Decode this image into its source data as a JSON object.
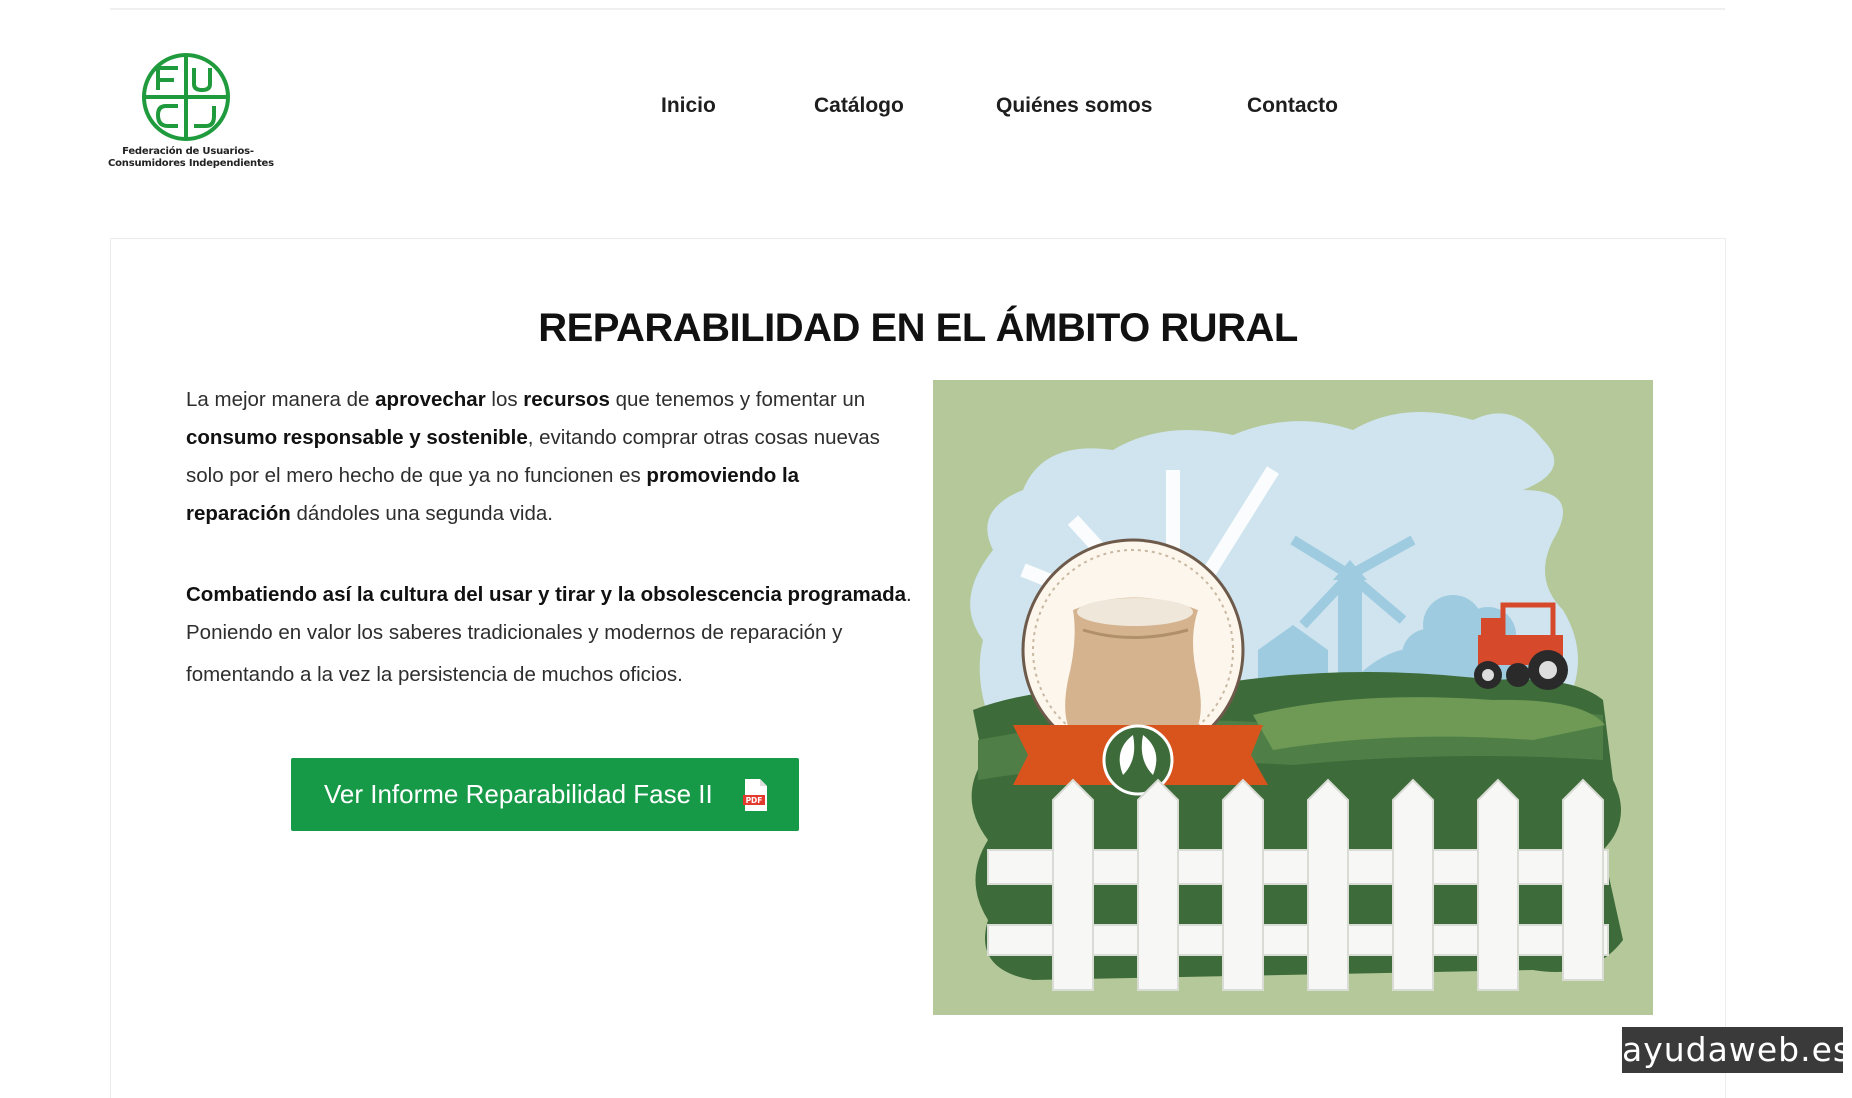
{
  "header": {
    "logo": {
      "letters": "FUCI",
      "line1": "Federación de Usuarios-",
      "line2": "Consumidores Independientes"
    },
    "nav": [
      {
        "label": "Inicio"
      },
      {
        "label": "Catálogo"
      },
      {
        "label": "Quiénes somos"
      },
      {
        "label": "Contacto"
      }
    ]
  },
  "main": {
    "title": "REPARABILIDAD EN EL ÁMBITO RURAL",
    "paragraph1": {
      "t1": "La mejor manera de ",
      "b1": "aprovechar",
      "t2": " los ",
      "b2": "recursos",
      "t3": " que tenemos y fomentar un",
      "b3": "consumo responsable y sostenible",
      "t4": ", evitando comprar otras cosas nuevas",
      "t5": "solo por el mero hecho de que ya no funcionen es ",
      "b4": "promoviendo la",
      "b5": "reparación",
      "t6": " dándoles una segunda vida."
    },
    "paragraph2": {
      "b1": "Combatiendo así la cultura del usar y tirar y la obsolescencia programada",
      "t1": ".",
      "t2": "Poniendo en valor los saberes tradicionales y modernos de reparación y",
      "t3": "fomentando a la vez la persistencia de muchos oficios."
    },
    "cta": {
      "label": "Ver Informe Reparabilidad Fase II",
      "icon": "pdf-file-icon",
      "icon_text": "PDF"
    },
    "illustration": {
      "subject": "rural-farm-illustration"
    }
  },
  "watermark": "ayudaweb.es",
  "colors": {
    "accent_green": "#179a48",
    "logo_green": "#1f9a3c",
    "illustration_bg": "#b4c89a",
    "ribbon_orange": "#d9541c",
    "tractor_red": "#d64a2b"
  }
}
